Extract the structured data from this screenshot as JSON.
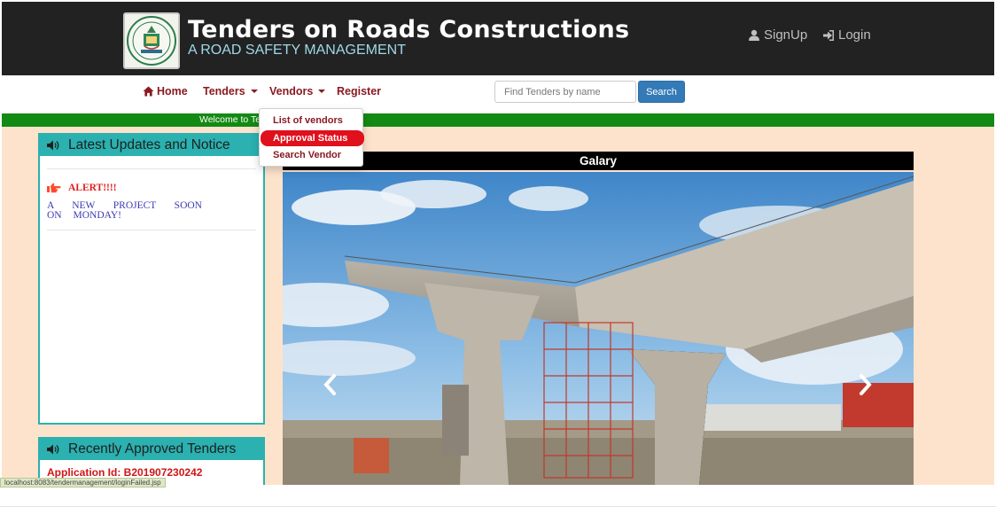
{
  "header": {
    "title": "Tenders on Roads Constructions",
    "subtitle": "A ROAD SAFETY MANAGEMENT",
    "signup": "SignUp",
    "login": "Login"
  },
  "nav": {
    "home": "Home",
    "tenders": "Tenders",
    "vendors": "Vendors",
    "register": "Register",
    "search_placeholder": "Find Tenders by name",
    "search_button": "Search"
  },
  "vendors_menu": {
    "items": [
      "List of vendors",
      "Approval Status",
      "Search Vendor"
    ],
    "highlighted_index": 1
  },
  "ticker": {
    "text": "Welcome to Tenders"
  },
  "updates_panel": {
    "title": "Latest Updates and Notice",
    "alert": "ALERT!!!!",
    "notice": "A NEW PROJECT SOON ON MONDAY!"
  },
  "approved_panel": {
    "title": "Recently Approved Tenders",
    "entry": "Application Id: B201907230242"
  },
  "gallery": {
    "title": "Galary"
  },
  "status_bar": {
    "url": "localhost:8083/tendermanagement/loginFailed.jsp"
  },
  "colors": {
    "header_bg": "#222222",
    "nav_link": "#8a1a22",
    "ticker_bg": "#138a13",
    "content_bg": "#fde3cc",
    "panel_accent": "#2ab1b0",
    "menu_highlight": "#e0101c"
  },
  "icons": {
    "home": "home-icon",
    "user": "user-icon",
    "login": "login-icon",
    "volume": "volume-icon",
    "hand_pointer": "hand-right-icon",
    "prev": "chevron-left-icon",
    "next": "chevron-right-icon"
  }
}
